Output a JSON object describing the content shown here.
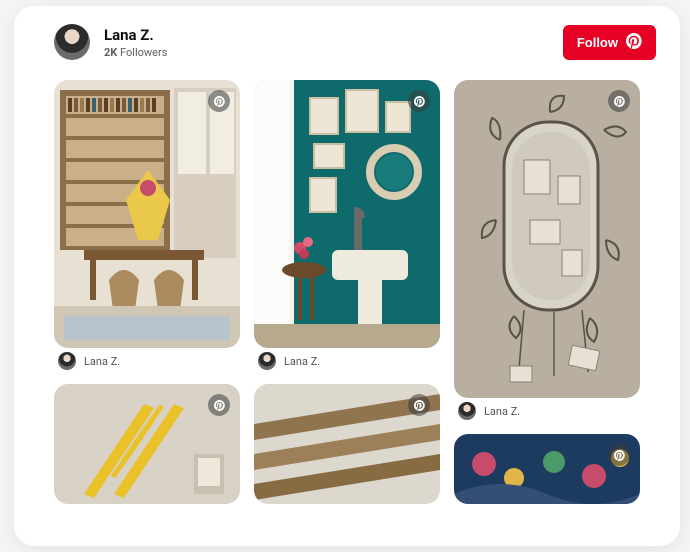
{
  "profile": {
    "name": "Lana Z.",
    "followers_count": "2K",
    "followers_label": "Followers"
  },
  "actions": {
    "follow_label": "Follow"
  },
  "pins": {
    "attribution": "Lana Z."
  }
}
